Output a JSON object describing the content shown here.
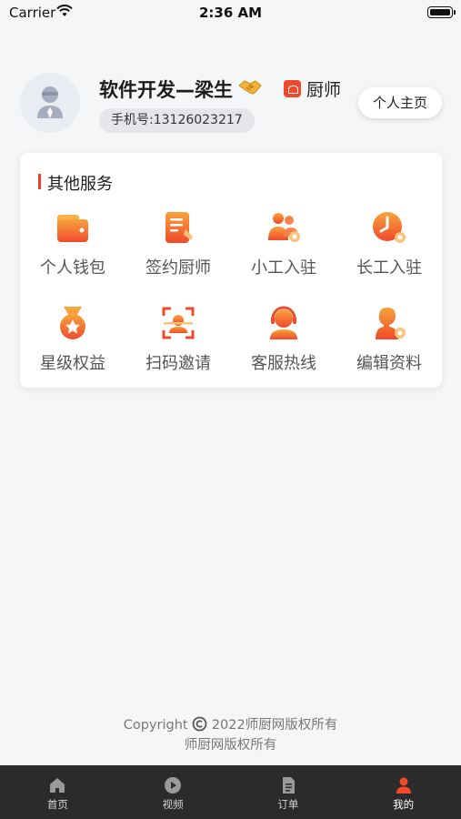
{
  "status_bar": {
    "carrier": "Carrier",
    "time": "2:36 AM"
  },
  "profile": {
    "name": "软件开发—梁生",
    "role": "厨师",
    "phone": "手机号:13126023217",
    "homepage_button": "个人主页"
  },
  "services": {
    "title": "其他服务",
    "items": [
      {
        "label": "个人钱包",
        "icon": "wallet-icon"
      },
      {
        "label": "签约厨师",
        "icon": "contract-icon"
      },
      {
        "label": "小工入驻",
        "icon": "group-icon"
      },
      {
        "label": "长工入驻",
        "icon": "clock-icon"
      },
      {
        "label": "星级权益",
        "icon": "medal-icon"
      },
      {
        "label": "扫码邀请",
        "icon": "scan-icon"
      },
      {
        "label": "客服热线",
        "icon": "headset-icon"
      },
      {
        "label": "编辑资料",
        "icon": "user-settings-icon"
      }
    ]
  },
  "footer": {
    "copyright_prefix": "Copyright",
    "copyright_text": "2022师厨网版权所有",
    "line2": "师厨网版权所有"
  },
  "tabs": [
    {
      "label": "首页",
      "icon": "home-icon"
    },
    {
      "label": "视频",
      "icon": "play-icon"
    },
    {
      "label": "订单",
      "icon": "document-icon"
    },
    {
      "label": "我的",
      "icon": "person-icon",
      "active": true
    }
  ],
  "colors": {
    "accent": "#f04a2b",
    "icon_gradient_start": "#f7a03a",
    "tab_bar": "#2b2b2b"
  }
}
